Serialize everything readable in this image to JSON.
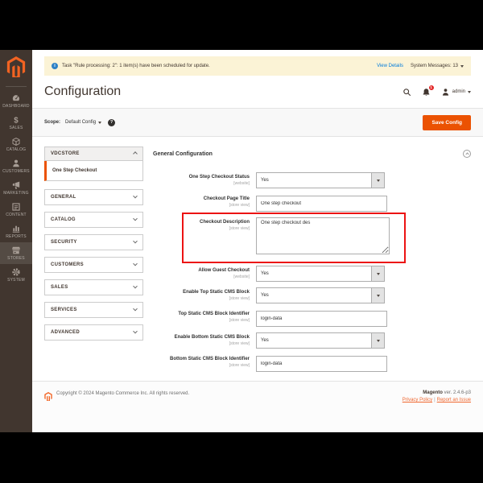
{
  "sidebar": {
    "items": [
      {
        "label": "DASHBOARD",
        "icon": "dashboard-icon",
        "active": false
      },
      {
        "label": "SALES",
        "icon": "sales-icon",
        "active": false
      },
      {
        "label": "CATALOG",
        "icon": "catalog-icon",
        "active": false
      },
      {
        "label": "CUSTOMERS",
        "icon": "customers-icon",
        "active": false
      },
      {
        "label": "MARKETING",
        "icon": "marketing-icon",
        "active": false
      },
      {
        "label": "CONTENT",
        "icon": "content-icon",
        "active": false
      },
      {
        "label": "REPORTS",
        "icon": "reports-icon",
        "active": false
      },
      {
        "label": "STORES",
        "icon": "stores-icon",
        "active": true
      },
      {
        "label": "SYSTEM",
        "icon": "system-icon",
        "active": false
      }
    ]
  },
  "notification": {
    "message": "Task \"Rule processing: 2\": 1 item(s) have been scheduled for update.",
    "view_details": "View Details",
    "system_messages": "System Messages: 13"
  },
  "header": {
    "title": "Configuration",
    "notifications_count": "1",
    "user": "admin"
  },
  "scope": {
    "label": "Scope:",
    "value": "Default Config",
    "save_button": "Save Config"
  },
  "config_nav": {
    "section": "VDCSTORE",
    "active_item": "One Step Checkout",
    "collapsed_sections": [
      "GENERAL",
      "CATALOG",
      "SECURITY",
      "CUSTOMERS",
      "SALES",
      "SERVICES",
      "ADVANCED"
    ]
  },
  "form": {
    "heading": "General Configuration",
    "fields": [
      {
        "label": "One Step Checkout Status",
        "scope_hint": "[website]",
        "type": "select",
        "value": "Yes",
        "highlighted": false
      },
      {
        "label": "Checkout Page Title",
        "scope_hint": "[store view]",
        "type": "text",
        "value": "One step checkout",
        "highlighted": false
      },
      {
        "label": "Checkout Description",
        "scope_hint": "[store view]",
        "type": "textarea",
        "value": "One step checkout des",
        "highlighted": true
      },
      {
        "label": "Allow Guest Checkout",
        "scope_hint": "[website]",
        "type": "select",
        "value": "Yes",
        "highlighted": false
      },
      {
        "label": "Enable Top Static CMS Block",
        "scope_hint": "[store view]",
        "type": "select",
        "value": "Yes",
        "highlighted": false
      },
      {
        "label": "Top Static CMS Block Identifier",
        "scope_hint": "[store view]",
        "type": "text",
        "value": "login-data",
        "highlighted": false
      },
      {
        "label": "Enable Bottom Static CMS Block",
        "scope_hint": "[store view]",
        "type": "select",
        "value": "Yes",
        "highlighted": false
      },
      {
        "label": "Bottom Static CMS Block Identifier",
        "scope_hint": "[store view]",
        "type": "text",
        "value": "login-data",
        "highlighted": false
      }
    ]
  },
  "footer": {
    "copyright": "Copyright © 2024 Magento Commerce Inc. All rights reserved.",
    "version_brand": "Magento",
    "version_rest": " ver. 2.4.6-p3",
    "links": [
      "Privacy Policy",
      "Report an Issue"
    ]
  },
  "colors": {
    "accent_orange": "#eb5202",
    "sidebar_bg": "#41362f",
    "highlight_red": "#ec1313",
    "link_blue": "#007bdb",
    "notif_yellow": "#fbf3d6"
  }
}
